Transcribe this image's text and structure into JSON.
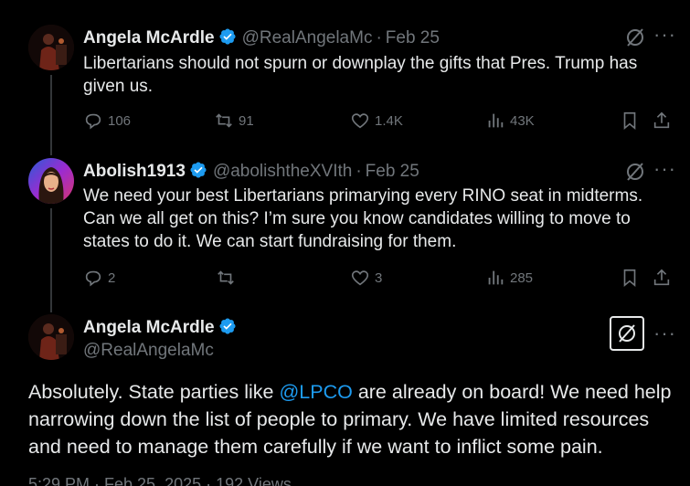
{
  "tweets": [
    {
      "name": "Angela McArdle",
      "handle": "@RealAngelaMc",
      "separator": "·",
      "date": "Feb 25",
      "text": "Libertarians should not spurn or downplay the gifts that Pres. Trump has given us.",
      "stats": {
        "replies": "106",
        "reposts": "91",
        "likes": "1.4K",
        "views": "43K"
      }
    },
    {
      "name": "Abolish1913",
      "handle": "@abolishtheXVIth",
      "separator": "·",
      "date": "Feb 25",
      "text": "We need your best Libertarians primarying every RINO seat in midterms. Can we all get on this? I’m sure you know candidates willing to move to states to do it. We can start fundraising for them.",
      "stats": {
        "replies": "2",
        "reposts": "",
        "likes": "3",
        "views": "285"
      }
    }
  ],
  "main_tweet": {
    "name": "Angela McArdle",
    "handle": "@RealAngelaMc",
    "text_before": "Absolutely. State parties like ",
    "mention": "@LPCO",
    "text_after": " are already on board! We need help narrowing down the list of people to primary. We have limited resources and need to manage them carefully if we want to inflict some pain.",
    "meta": "5:29 PM · Feb 25, 2025 · 192 Views"
  },
  "colors": {
    "accent": "#1d9bf0",
    "muted": "#71767b",
    "text": "#e7e9ea",
    "background": "#000000"
  },
  "icons": [
    "reply-icon",
    "repost-icon",
    "like-icon",
    "views-icon",
    "bookmark-icon",
    "share-icon",
    "grok-icon",
    "more-icon",
    "verified-badge-icon"
  ]
}
